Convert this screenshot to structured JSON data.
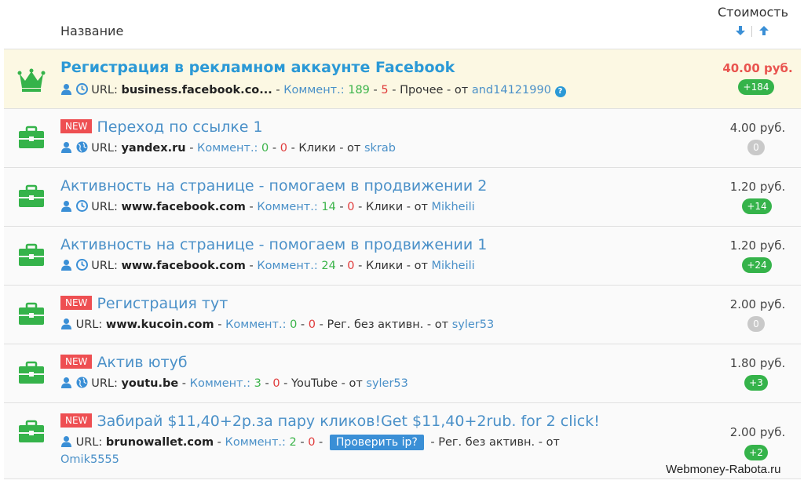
{
  "header": {
    "name_label": "Название",
    "cost_label": "Стоимость"
  },
  "rows": [
    {
      "icon": "crown-icon",
      "is_new": false,
      "title": "Регистрация в рекламном аккаунте Facebook",
      "url_label": "URL:",
      "url": "business.facebook.co...",
      "comments_label": "Коммент.:",
      "comments_plus": "189",
      "comments_minus": "5",
      "category": "Прочее",
      "from_label": "от",
      "author": "and14121990",
      "price": "40.00 руб.",
      "count": "+184"
    },
    {
      "icon": "briefcase-icon",
      "is_new": true,
      "new_label": "NEW",
      "title": "Переход по ссылке 1",
      "url_label": "URL:",
      "url": "yandex.ru",
      "comments_label": "Коммент.:",
      "comments_plus": "0",
      "comments_minus": "0",
      "category": "Клики",
      "from_label": "от",
      "author": "skrab",
      "price": "4.00 руб.",
      "count": "0"
    },
    {
      "icon": "briefcase-icon",
      "is_new": false,
      "title": "Активность на странице - помогаем в продвижении 2",
      "url_label": "URL:",
      "url": "www.facebook.com",
      "comments_label": "Коммент.:",
      "comments_plus": "14",
      "comments_minus": "0",
      "category": "Клики",
      "from_label": "от",
      "author": "Mikheili",
      "price": "1.20 руб.",
      "count": "+14"
    },
    {
      "icon": "briefcase-icon",
      "is_new": false,
      "title": "Активность на странице - помогаем в продвижении 1",
      "url_label": "URL:",
      "url": "www.facebook.com",
      "comments_label": "Коммент.:",
      "comments_plus": "24",
      "comments_minus": "0",
      "category": "Клики",
      "from_label": "от",
      "author": "Mikheili",
      "price": "1.20 руб.",
      "count": "+24"
    },
    {
      "icon": "briefcase-icon",
      "is_new": true,
      "new_label": "NEW",
      "title": "Регистрация тут",
      "url_label": "URL:",
      "url": "www.kucoin.com",
      "comments_label": "Коммент.:",
      "comments_plus": "0",
      "comments_minus": "0",
      "category": "Рег. без активн.",
      "from_label": "от",
      "author": "syler53",
      "price": "2.00 руб.",
      "count": "0"
    },
    {
      "icon": "briefcase-icon",
      "is_new": true,
      "new_label": "NEW",
      "title": "Актив ютуб",
      "url_label": "URL:",
      "url": "youtu.be",
      "comments_label": "Коммент.:",
      "comments_plus": "3",
      "comments_minus": "0",
      "category": "YouTube",
      "from_label": "от",
      "author": "syler53",
      "price": "1.80 руб.",
      "count": "+3"
    },
    {
      "icon": "briefcase-icon",
      "is_new": true,
      "new_label": "NEW",
      "title": "Забирай $11,40+2р.за пару кликов!Get $11,40+2rub. for 2 click!",
      "url_label": "URL:",
      "url": "brunowallet.com",
      "comments_label": "Коммент.:",
      "comments_plus": "2",
      "comments_minus": "0",
      "check_button": "Проверить ip?",
      "category": "Рег. без активн.",
      "from_label": "от",
      "author": "Omik5555",
      "price": "2.00 руб.",
      "count": "+2"
    }
  ],
  "watermark": "Webmoney-Rabota.ru",
  "colors": {
    "highlight_bg": "#fcf8e3",
    "link": "#4a90c8",
    "green": "#35b34a",
    "red": "#e03b3b",
    "new_badge": "#ee4f52"
  }
}
